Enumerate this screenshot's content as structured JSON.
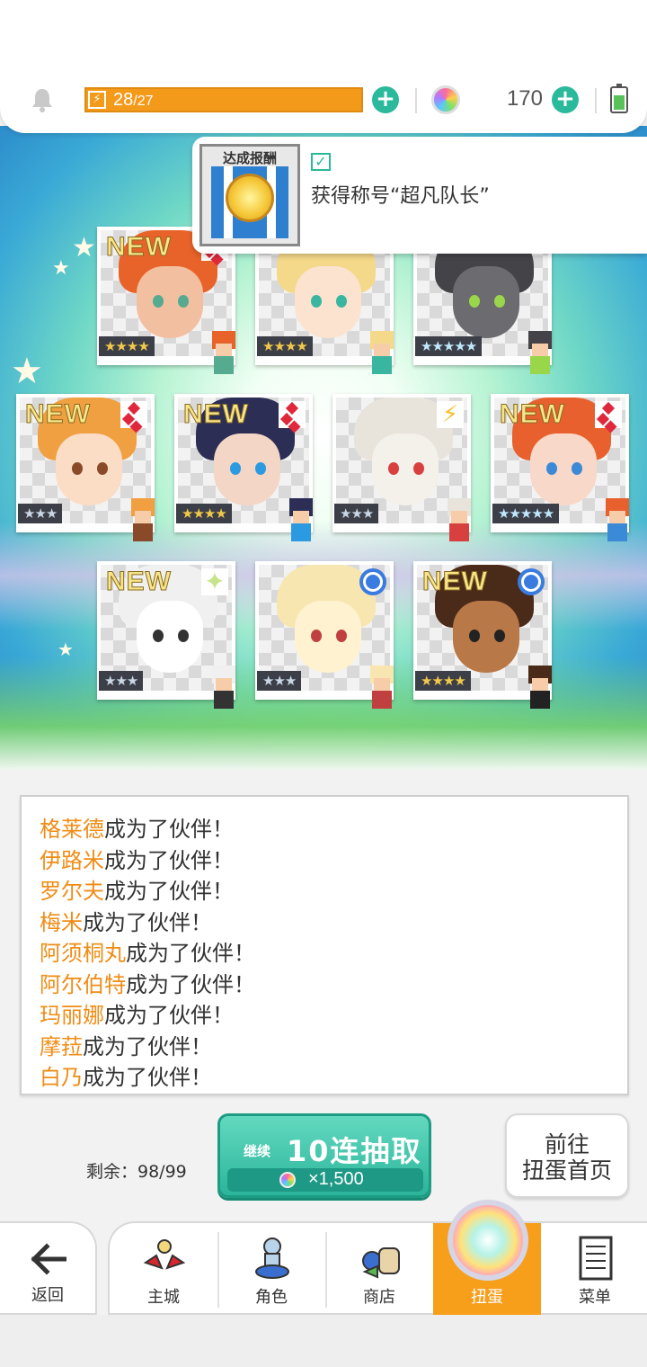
{
  "topbar": {
    "energy_current": "28",
    "energy_max": "/27",
    "energy_fill_fraction": 1.0,
    "gems": "170",
    "icons": [
      "bell-icon",
      "energy-bolt-icon",
      "plus-icon",
      "rainbow-gem-icon",
      "battery-icon"
    ]
  },
  "achievement": {
    "badge_title": "达成报酬",
    "text": "获得称号“超凡队长”"
  },
  "cards": [
    {
      "new": "NEW",
      "rarity": "★★★★",
      "rarity_class": "",
      "element": "red"
    },
    {
      "new": "",
      "rarity": "★★★★",
      "rarity_class": "",
      "element": ""
    },
    {
      "new": "",
      "rarity": "★★★★★",
      "rarity_class": "rainbow",
      "element": ""
    },
    {
      "new": "NEW",
      "rarity": "★★★",
      "rarity_class": "silver",
      "element": "red"
    },
    {
      "new": "NEW",
      "rarity": "★★★★",
      "rarity_class": "",
      "element": "red"
    },
    {
      "new": "",
      "rarity": "★★★",
      "rarity_class": "silver",
      "element": "yellow"
    },
    {
      "new": "NEW",
      "rarity": "★★★★★",
      "rarity_class": "rainbow",
      "element": "red"
    },
    {
      "new": "NEW",
      "rarity": "★★★",
      "rarity_class": "silver",
      "element": "green"
    },
    {
      "new": "",
      "rarity": "★★★",
      "rarity_class": "silver",
      "element": "blue"
    },
    {
      "new": "NEW",
      "rarity": "★★★★",
      "rarity_class": "",
      "element": "blue"
    }
  ],
  "log": {
    "suffix": "成为了伙伴！",
    "names": [
      "格莱德",
      "伊路米",
      "罗尔夫",
      "梅米",
      "阿须桐丸",
      "阿尔伯特",
      "玛丽娜",
      "摩菈",
      "白乃"
    ]
  },
  "gacha": {
    "remaining": "剩余：98/99",
    "continue_label": "继续",
    "pull_label": "10连抽取",
    "cost": "×1,500",
    "home_line1": "前往",
    "home_line2": "扭蛋首页"
  },
  "nav": {
    "back": "返回",
    "items": [
      "主城",
      "角色",
      "商店",
      "扭蛋",
      "菜单"
    ],
    "active_index": 3,
    "colors": {
      "active": "#f79e1b",
      "accent": "#2ab99b"
    }
  }
}
